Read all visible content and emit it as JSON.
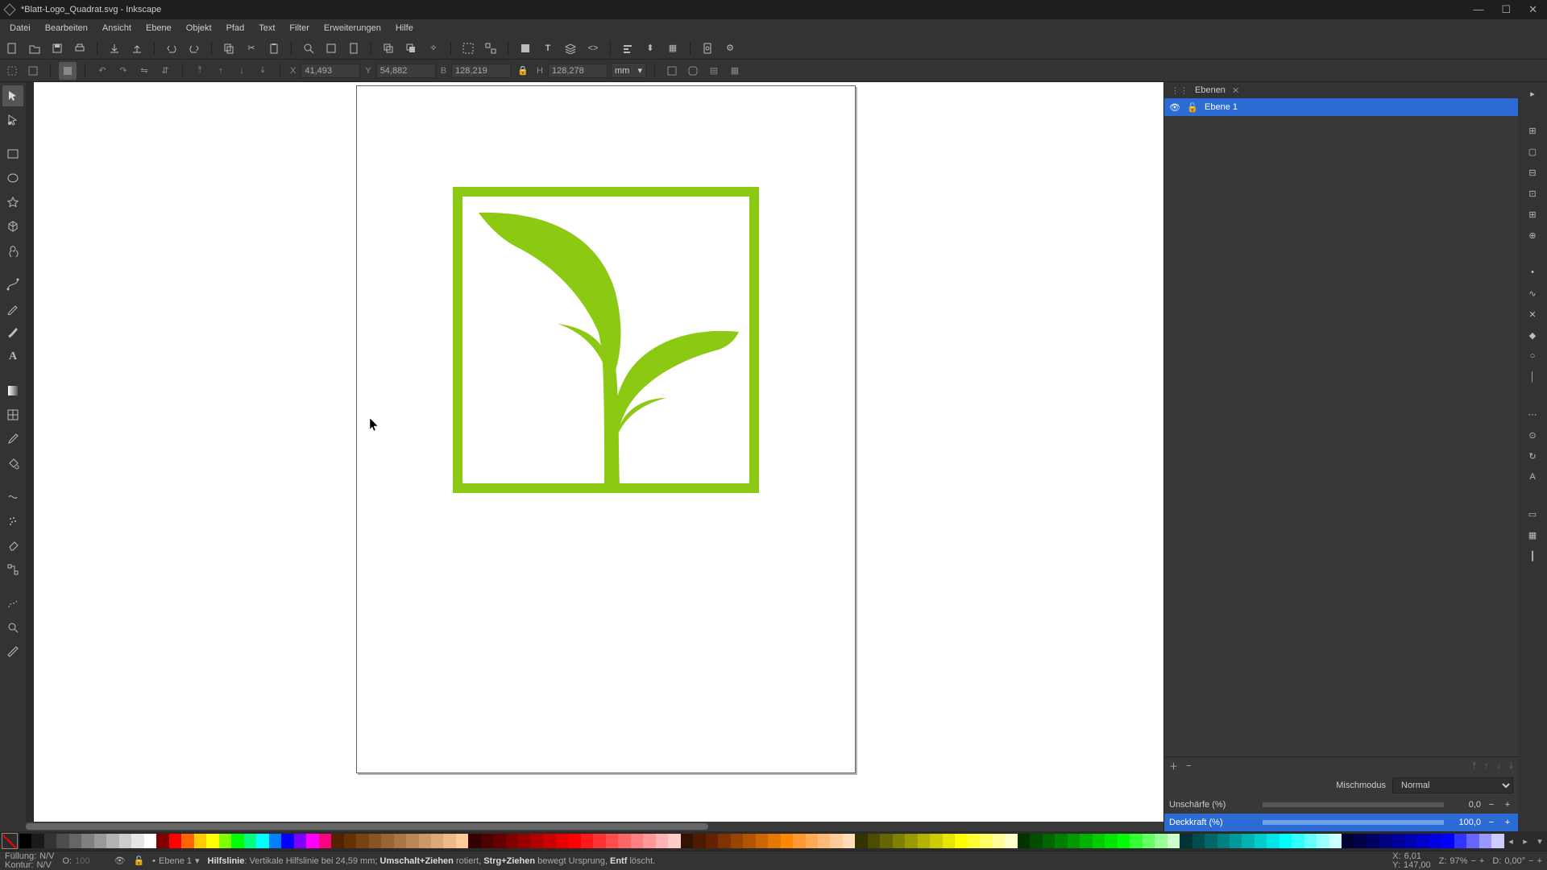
{
  "title": "*Blatt-Logo_Quadrat.svg - Inkscape",
  "menu": [
    "Datei",
    "Bearbeiten",
    "Ansicht",
    "Ebene",
    "Objekt",
    "Pfad",
    "Text",
    "Filter",
    "Erweiterungen",
    "Hilfe"
  ],
  "toolctl": {
    "x_label": "X",
    "x": "41,493",
    "y_label": "Y",
    "y": "54,882",
    "w_label": "B",
    "w": "128,219",
    "h_label": "H",
    "h": "128,278",
    "unit": "mm"
  },
  "panel": {
    "title": "Ebenen",
    "layer": "Ebene 1",
    "blend_label": "Mischmodus",
    "blend_value": "Normal",
    "blur_label": "Unschärfe (%)",
    "blur_value": "0,0",
    "opacity_label": "Deckkraft (%)",
    "opacity_value": "100,0"
  },
  "status": {
    "fill_label": "Füllung:",
    "fill_value": "N/V",
    "stroke_label": "Kontur:",
    "stroke_value": "N/V",
    "o_label": "O:",
    "o_value": "100",
    "layer": "Ebene 1",
    "hint_prefix": "Hilfslinie",
    "hint_main": ": Vertikale Hilfslinie bei 24,59 mm; ",
    "hint_b1": "Umschalt+Ziehen",
    "hint_t1": " rotiert, ",
    "hint_b2": "Strg+Ziehen",
    "hint_t2": " bewegt Ursprung, ",
    "hint_b3": "Entf",
    "hint_t3": " löscht.",
    "x_label": "X:",
    "x": "6,01",
    "y_label": "Y:",
    "y": "147,00",
    "z_label": "Z:",
    "zoom": "97%",
    "d_label": "D:",
    "rot": "0,00°"
  },
  "colors": {
    "leaf": "#8BC913"
  },
  "palette": [
    "#000000",
    "#1a1a1a",
    "#333333",
    "#4d4d4d",
    "#666666",
    "#808080",
    "#999999",
    "#b3b3b3",
    "#cccccc",
    "#e6e6e6",
    "#ffffff",
    "#800000",
    "#ff0000",
    "#ff6600",
    "#ffcc00",
    "#ffff00",
    "#80ff00",
    "#00ff00",
    "#00ff80",
    "#00ffff",
    "#0080ff",
    "#0000ff",
    "#8000ff",
    "#ff00ff",
    "#ff0080",
    "#552200",
    "#663300",
    "#774411",
    "#885522",
    "#996633",
    "#aa7744",
    "#bb8855",
    "#cc9966",
    "#ddaa77",
    "#eebb88",
    "#ffcc99",
    "#330000",
    "#4d0000",
    "#660000",
    "#800000",
    "#990000",
    "#b30000",
    "#cc0000",
    "#e60000",
    "#ff0000",
    "#ff1a1a",
    "#ff3333",
    "#ff4d4d",
    "#ff6666",
    "#ff8080",
    "#ff9999",
    "#ffb3b3",
    "#ffcccc",
    "#331100",
    "#4d1a00",
    "#662200",
    "#803300",
    "#994400",
    "#b35500",
    "#cc6600",
    "#e67700",
    "#ff8800",
    "#ff9933",
    "#ffaa55",
    "#ffbb77",
    "#ffcc99",
    "#ffddbb",
    "#333300",
    "#4d4d00",
    "#666600",
    "#808000",
    "#999900",
    "#b3b300",
    "#cccc00",
    "#e6e600",
    "#ffff00",
    "#ffff33",
    "#ffff66",
    "#ffff99",
    "#ffffcc",
    "#003300",
    "#004d00",
    "#006600",
    "#008000",
    "#009900",
    "#00b300",
    "#00cc00",
    "#00e600",
    "#00ff00",
    "#33ff33",
    "#66ff66",
    "#99ff99",
    "#ccffcc",
    "#003333",
    "#004d4d",
    "#006666",
    "#008080",
    "#009999",
    "#00b3b3",
    "#00cccc",
    "#00e6e6",
    "#00ffff",
    "#33ffff",
    "#66ffff",
    "#99ffff",
    "#ccffff",
    "#000033",
    "#00004d",
    "#000066",
    "#000080",
    "#000099",
    "#0000b3",
    "#0000cc",
    "#0000e6",
    "#0000ff",
    "#3333ff",
    "#6666ff",
    "#9999ff",
    "#ccccff"
  ]
}
